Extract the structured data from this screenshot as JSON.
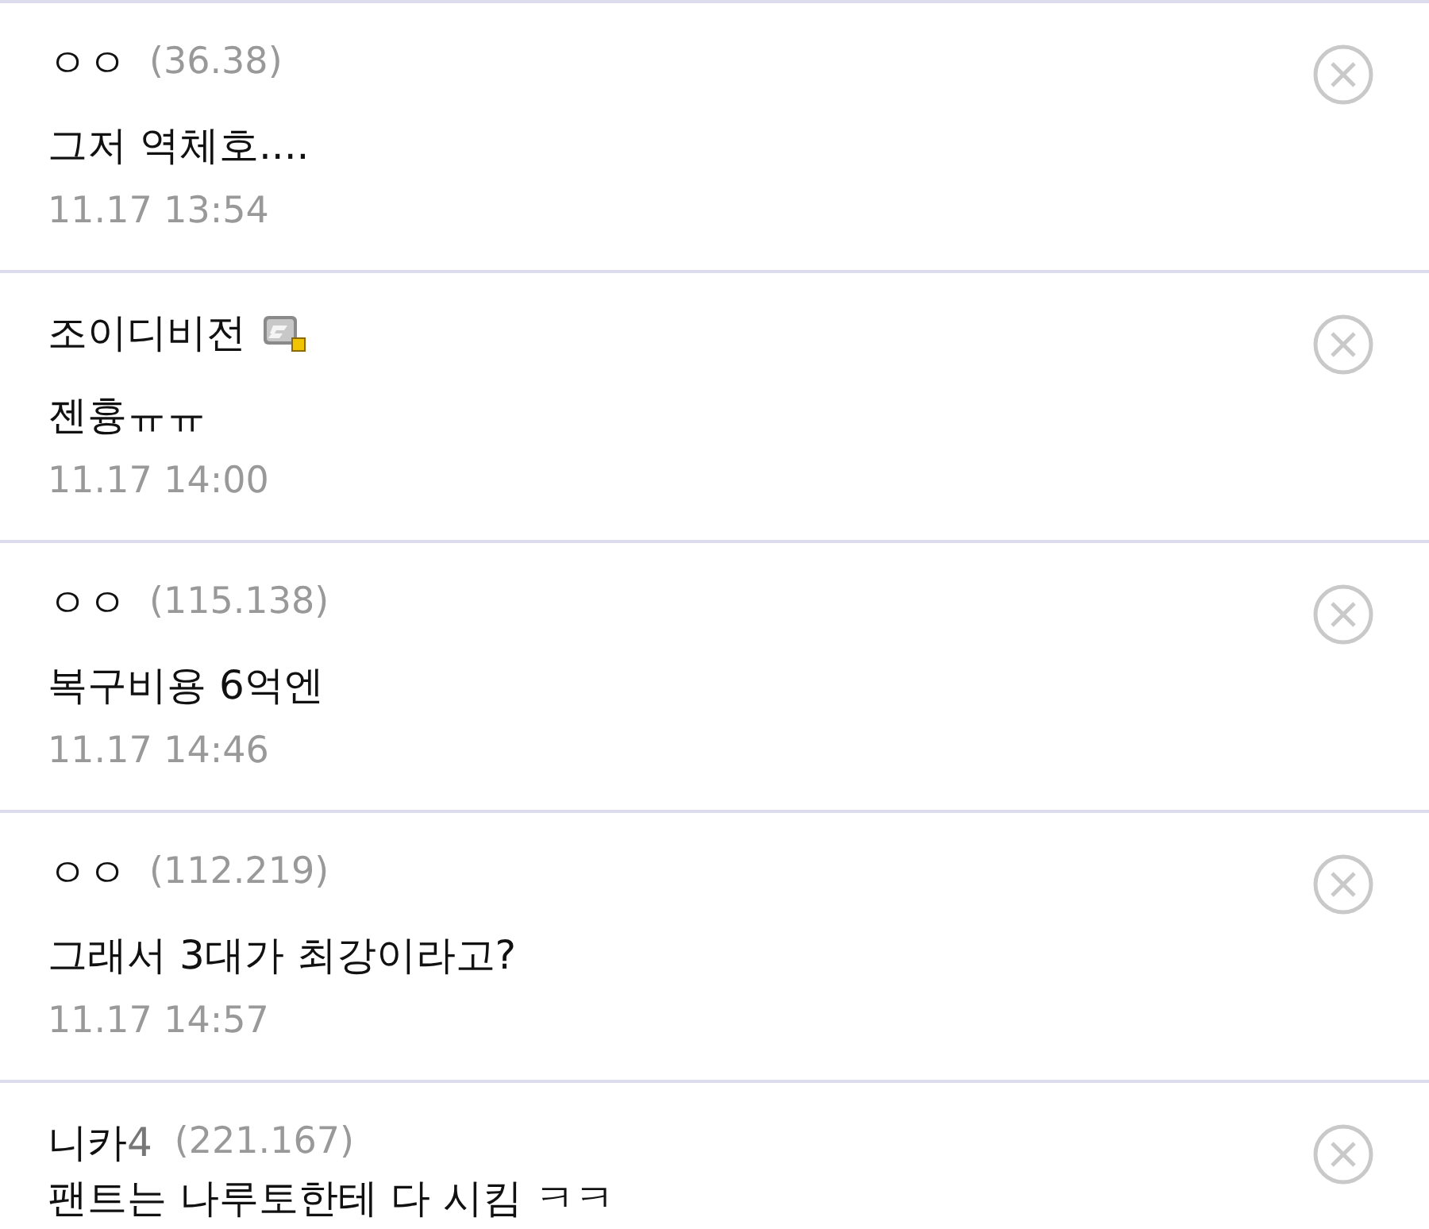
{
  "comments": [
    {
      "name": "ㅇㅇ",
      "ip": "(36.38)",
      "badge": false,
      "text": "그저 역체호....",
      "time": "11.17 13:54"
    },
    {
      "name": "조이디비전",
      "badge": true,
      "text": "젠흉ㅠㅠ",
      "time": "11.17 14:00"
    },
    {
      "name": "ㅇㅇ",
      "ip": "(115.138)",
      "badge": false,
      "text": "복구비용 6억엔",
      "time": "11.17 14:46"
    },
    {
      "name": "ㅇㅇ",
      "ip": "(112.219)",
      "badge": false,
      "text": "그래서 3대가 최강이라고?",
      "time": "11.17 14:57"
    },
    {
      "name": "니카",
      "name_suffix": "4",
      "ip": "(221.167)",
      "badge": false,
      "text": "팬트는 나루토한테 다 시킴 ㅋㅋ"
    }
  ]
}
